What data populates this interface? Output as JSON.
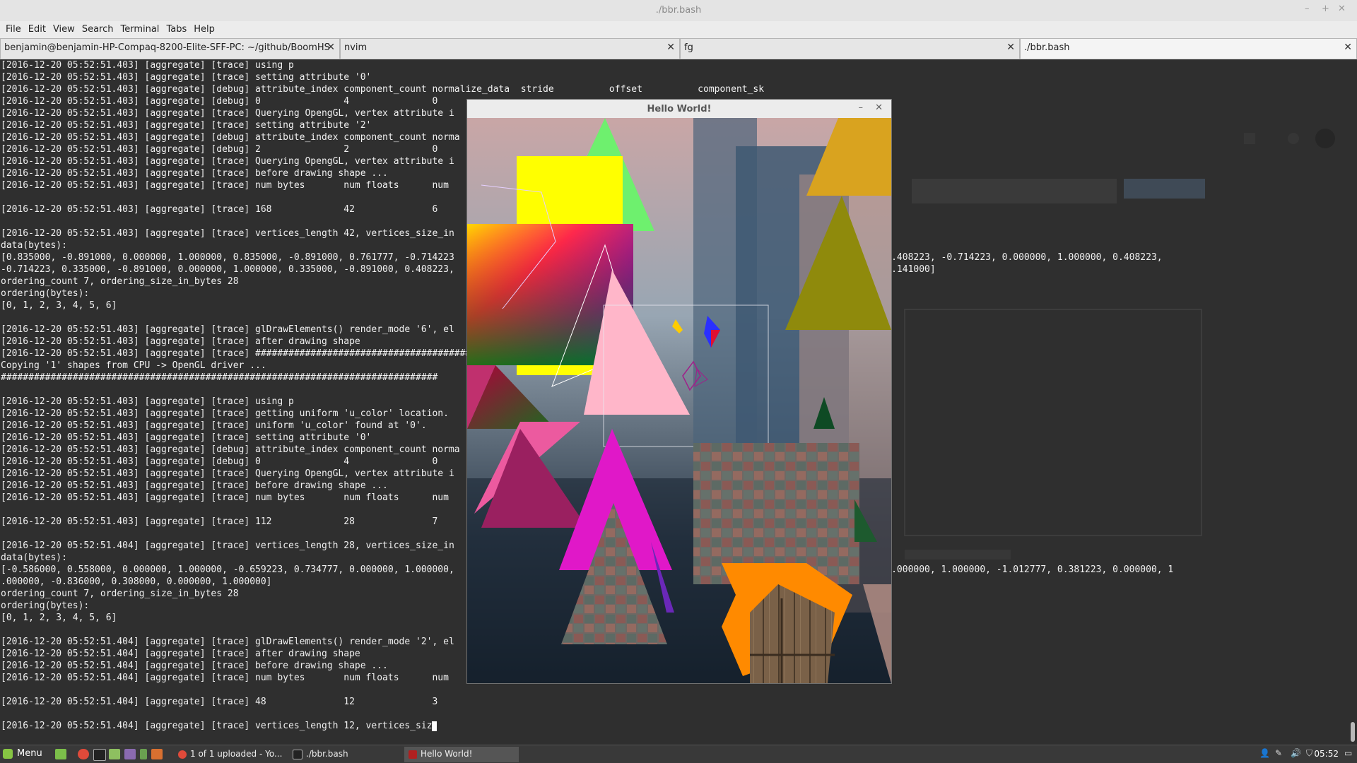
{
  "window": {
    "title": "./bbr.bash"
  },
  "menubar": [
    "File",
    "Edit",
    "View",
    "Search",
    "Terminal",
    "Tabs",
    "Help"
  ],
  "tabs": [
    {
      "label": "benjamin@benjamin-HP-Compaq-8200-Elite-SFF-PC: ~/github/BoomHS",
      "close": "✕"
    },
    {
      "label": "nvim",
      "close": "✕"
    },
    {
      "label": "fg",
      "close": "✕"
    },
    {
      "label": "./bbr.bash",
      "close": "✕"
    }
  ],
  "terminal": {
    "lines": [
      "[2016-12-20 05:52:51.403] [aggregate] [trace] using p",
      "[2016-12-20 05:52:51.403] [aggregate] [trace] setting attribute '0'",
      "[2016-12-20 05:52:51.403] [aggregate] [debug] attribute_index component_count normalize_data  stride          offset          component_sk",
      "[2016-12-20 05:52:51.403] [aggregate] [debug] 0               4               0",
      "[2016-12-20 05:52:51.403] [aggregate] [trace] Querying OpengGL, vertex attribute i",
      "[2016-12-20 05:52:51.403] [aggregate] [trace] setting attribute '2'",
      "[2016-12-20 05:52:51.403] [aggregate] [debug] attribute_index component_count norma",
      "[2016-12-20 05:52:51.403] [aggregate] [debug] 2               2               0",
      "[2016-12-20 05:52:51.403] [aggregate] [trace] Querying OpengGL, vertex attribute i",
      "[2016-12-20 05:52:51.403] [aggregate] [trace] before drawing shape ...",
      "[2016-12-20 05:52:51.403] [aggregate] [trace] num bytes       num floats      num",
      "",
      "[2016-12-20 05:52:51.403] [aggregate] [trace] 168             42              6",
      "",
      "[2016-12-20 05:52:51.403] [aggregate] [trace] vertices_length 42, vertices_size_in                                                                                                        ",
      "data(bytes):",
      "[0.835000, -0.891000, 0.000000, 1.000000, 0.835000, -0.891000, 0.761777, -0.714223                                                 000000, 0.585000, -0.641000, 0.408223, -0.714223, 0.000000, 1.000000, 0.408223,",
      "-0.714223, 0.335000, -0.891000, 0.000000, 1.000000, 0.335000, -0.891000, 0.408223,                                                 000000, 1.000000, 0.585000, -1.141000]",
      "ordering_count 7, ordering_size_in_bytes 28",
      "ordering(bytes):",
      "[0, 1, 2, 3, 4, 5, 6]",
      "",
      "[2016-12-20 05:52:51.403] [aggregate] [trace] glDrawElements() render_mode '6', el",
      "[2016-12-20 05:52:51.403] [aggregate] [trace] after drawing shape",
      "[2016-12-20 05:52:51.403] [aggregate] [trace] ##########################################",
      "Copying '1' shapes from CPU -> OpenGL driver ...",
      "###############################################################################",
      "",
      "[2016-12-20 05:52:51.403] [aggregate] [trace] using p",
      "[2016-12-20 05:52:51.403] [aggregate] [trace] getting uniform 'u_color' location.",
      "[2016-12-20 05:52:51.403] [aggregate] [trace] uniform 'u_color' found at '0'.",
      "[2016-12-20 05:52:51.403] [aggregate] [trace] setting attribute '0'",
      "[2016-12-20 05:52:51.403] [aggregate] [debug] attribute_index component_count norma",
      "[2016-12-20 05:52:51.403] [aggregate] [debug] 0               4               0",
      "[2016-12-20 05:52:51.403] [aggregate] [trace] Querying OpengGL, vertex attribute i",
      "[2016-12-20 05:52:51.403] [aggregate] [trace] before drawing shape ...",
      "[2016-12-20 05:52:51.403] [aggregate] [trace] num bytes       num floats      num",
      "",
      "[2016-12-20 05:52:51.403] [aggregate] [trace] 112             28              7",
      "",
      "[2016-12-20 05:52:51.404] [aggregate] [trace] vertices_length 28, vertices_size_in",
      "data(bytes):",
      "[-0.586000, 0.558000, 0.000000, 1.000000, -0.659223, 0.734777, 0.000000, 1.000000,                                                 000000, -1.086000, 0.558000, 0.000000, 1.000000, -1.012777, 0.381223, 0.000000, 1",
      ".000000, -0.836000, 0.308000, 0.000000, 1.000000]",
      "ordering_count 7, ordering_size_in_bytes 28",
      "ordering(bytes):",
      "[0, 1, 2, 3, 4, 5, 6]",
      "",
      "[2016-12-20 05:52:51.404] [aggregate] [trace] glDrawElements() render_mode '2', el",
      "[2016-12-20 05:52:51.404] [aggregate] [trace] after drawing shape",
      "[2016-12-20 05:52:51.404] [aggregate] [trace] before drawing shape ...",
      "[2016-12-20 05:52:51.404] [aggregate] [trace] num bytes       num floats      num",
      "",
      "[2016-12-20 05:52:51.404] [aggregate] [trace] 48              12              3",
      "",
      "[2016-12-20 05:52:51.404] [aggregate] [trace] vertices_length 12, vertices_siz"
    ]
  },
  "hello_window": {
    "title": "Hello World!",
    "minimize": "–",
    "close": "✕"
  },
  "taskbar": {
    "menu_label": "Menu",
    "windows": [
      {
        "label": "1 of 1 uploaded - Yo...",
        "icon": "chrome-icon"
      },
      {
        "label": "./bbr.bash",
        "icon": "terminal-icon"
      },
      {
        "label": "Hello World!",
        "icon": "opengl-window-icon"
      }
    ],
    "clock": "05:52"
  },
  "colors": {
    "terminal_bg": "#2f2f2f",
    "terminal_fg": "#f0f0f0",
    "taskbar_bg": "#393939",
    "accent_green": "#87c543"
  }
}
